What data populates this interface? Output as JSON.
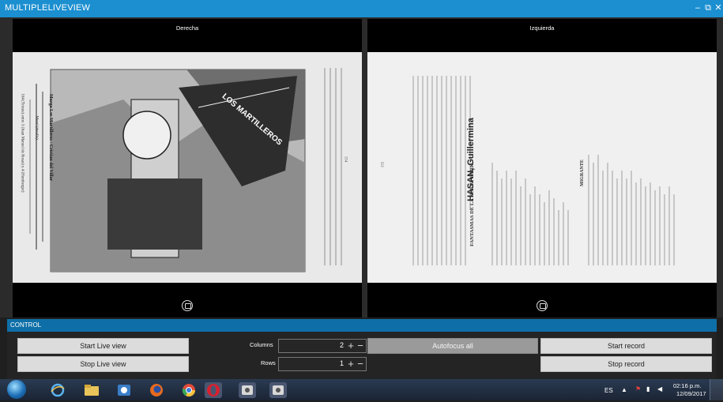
{
  "window": {
    "title": "MULTIPLELIVEVIEW",
    "minimize": "–",
    "restore": "⧉",
    "close": "✕"
  },
  "views": [
    {
      "label": "Derecha",
      "snapshot_icon": "camera-snapshot-icon"
    },
    {
      "label": "Izquierda",
      "snapshot_icon": "camera-snapshot-icon"
    }
  ],
  "control": {
    "title": "CONTROL",
    "start_live": "Start Live view",
    "stop_live": "Stop Live view",
    "columns_label": "Columns",
    "columns_value": "2",
    "rows_label": "Rows",
    "rows_value": "1",
    "autofocus": "Autofocus all",
    "start_record": "Start record",
    "stop_record": "Stop record"
  },
  "taskbar": {
    "icons": [
      "windows-start-icon",
      "ie-icon",
      "explorer-icon",
      "media-icon",
      "firefox-icon",
      "chrome-icon",
      "opera-icon",
      "camera-app-icon",
      "camera-app-icon"
    ],
    "lang": "ES",
    "time": "02:16 p.m.",
    "date": "12/09/2017"
  },
  "pages": {
    "left_caption": "Murga Los Martilleros · Cristian del Villar",
    "left_caption2": "164 (Trieste) entre 3 (Juan Manuel de Rosas) y 4 (Humberger)",
    "left_caption3": "Mural (detalle)",
    "right_heading": "HASAN, Guillermina",
    "right_sub": "FANTASMAS DE LA NUEVA YORK",
    "right_sub2": "MIGRANTE",
    "flag_text": "LOS MARTILLEROS",
    "left_pagenum": "154",
    "right_pagenum": "155"
  },
  "colors": {
    "accent": "#1b8fd0",
    "control": "#0e6fa8"
  }
}
